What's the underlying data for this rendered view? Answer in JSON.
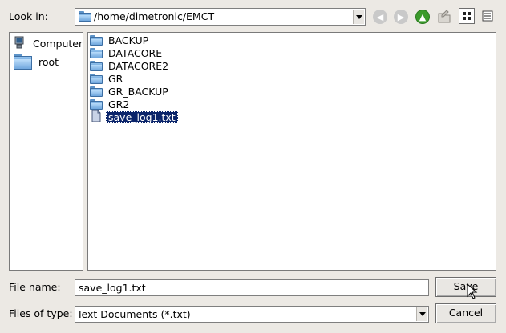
{
  "look_in": {
    "label": "Look in:",
    "path": "/home/dimetronic/EMCT"
  },
  "toolbar": {
    "back_icon": "back-arrow-icon",
    "forward_icon": "forward-arrow-icon",
    "parent_icon": "up-arrow-icon",
    "new_folder_icon": "new-folder-icon",
    "list_view_icon": "list-view-icon",
    "detail_view_icon": "detail-view-icon"
  },
  "sidebar": {
    "items": [
      {
        "label": "Computer",
        "icon": "computer-icon"
      },
      {
        "label": "root",
        "icon": "folder-icon"
      }
    ]
  },
  "files": {
    "items": [
      {
        "name": "BACKUP",
        "type": "folder"
      },
      {
        "name": "DATACORE",
        "type": "folder"
      },
      {
        "name": "DATACORE2",
        "type": "folder"
      },
      {
        "name": "GR",
        "type": "folder"
      },
      {
        "name": "GR_BACKUP",
        "type": "folder"
      },
      {
        "name": "GR2",
        "type": "folder"
      },
      {
        "name": "save_log1.txt",
        "type": "file",
        "selected": true
      }
    ]
  },
  "filename": {
    "label": "File name:",
    "value": "save_log1.txt"
  },
  "filetype": {
    "label": "Files of type:",
    "value": "Text Documents (*.txt)"
  },
  "buttons": {
    "save": "Save",
    "cancel": "Cancel"
  },
  "colors": {
    "selection": "#0a246a",
    "background": "#ece9e4",
    "folder": "#5b9bd5"
  }
}
